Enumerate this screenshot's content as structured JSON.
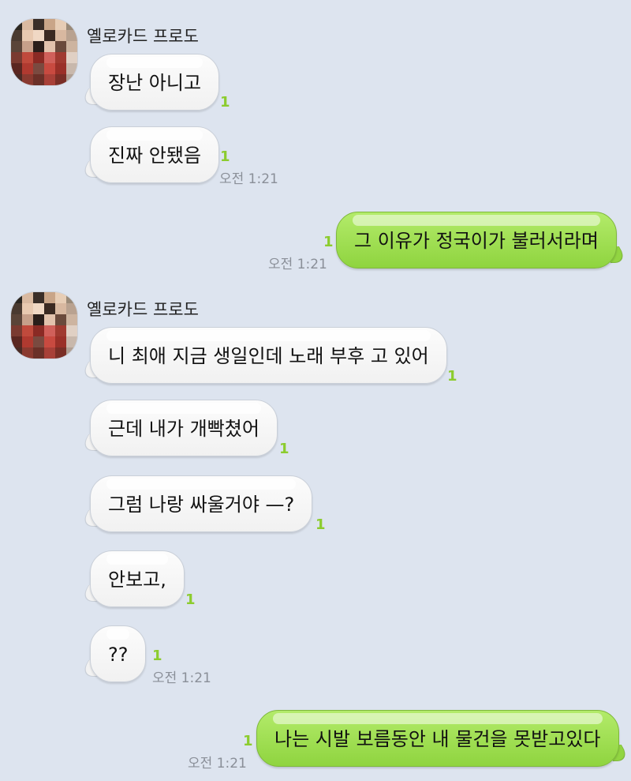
{
  "chat": {
    "groups": [
      {
        "sender": "옐로카드 프로도",
        "messages": [
          {
            "text": "장난 아니고",
            "unread": "1"
          },
          {
            "text": "진짜 안됐음",
            "unread": "1",
            "time": "오전 1:21"
          }
        ]
      },
      {
        "mine": true,
        "messages": [
          {
            "text": "그 이유가 정국이가 불러서라며",
            "unread": "1",
            "time": "오전 1:21"
          }
        ]
      },
      {
        "sender": "옐로카드 프로도",
        "messages": [
          {
            "text": "니 최애 지금 생일인데 노래 부후 고 있어",
            "unread": "1"
          },
          {
            "text": "근데 내가 개빡쳤어",
            "unread": "1"
          },
          {
            "text": "그럼 나랑 싸울거야 —?",
            "unread": "1"
          },
          {
            "text": "안보고,",
            "unread": "1"
          },
          {
            "text": "??",
            "unread": "1",
            "time": "오전 1:21"
          }
        ]
      },
      {
        "mine": true,
        "messages": [
          {
            "text": "나는 시발 보름동안 내 물건을 못받고있다",
            "unread": "1",
            "time": "오전 1:21"
          }
        ]
      }
    ]
  },
  "colors": {
    "background": "#dde4ef",
    "outgoing_bubble": "#9ddc4e",
    "incoming_bubble": "#f6f6f6",
    "unread_counter": "#8ccc2e",
    "timestamp": "#8a8f98"
  }
}
